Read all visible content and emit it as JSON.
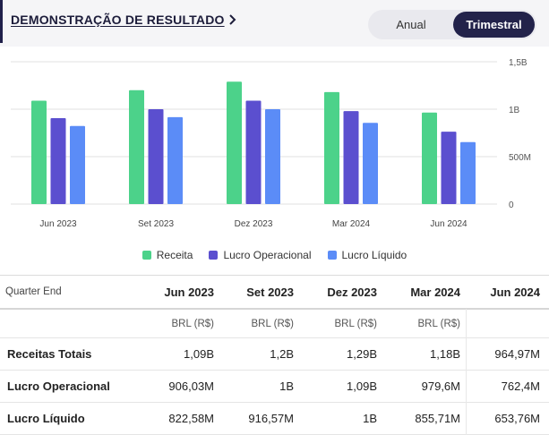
{
  "header": {
    "title": "DEMONSTRAÇÃO DE RESULTADO",
    "toggle": {
      "anual": "Anual",
      "trimestral": "Trimestral",
      "selected": "trimestral"
    }
  },
  "colors": {
    "receita": "#4cd28a",
    "lucro_operacional": "#5b4fcf",
    "lucro_liquido": "#5b8cf7",
    "accent": "#22224a"
  },
  "chart_data": {
    "type": "bar",
    "categories": [
      "Jun 2023",
      "Set 2023",
      "Dez 2023",
      "Mar 2024",
      "Jun 2024"
    ],
    "series": [
      {
        "name": "Receita",
        "values": [
          1.09,
          1.2,
          1.29,
          1.18,
          0.96497
        ]
      },
      {
        "name": "Lucro Operacional",
        "values": [
          0.90603,
          1.0,
          1.09,
          0.9796,
          0.7624
        ]
      },
      {
        "name": "Lucro Líquido",
        "values": [
          0.82258,
          0.91657,
          1.0,
          0.85571,
          0.65376
        ]
      }
    ],
    "ylim": [
      0,
      1.5
    ],
    "yticks": [
      0,
      0.5,
      1.0,
      1.5
    ],
    "ytick_labels": [
      "0",
      "500M",
      "1B",
      "1,5B"
    ],
    "grid": true,
    "legend": "bottom-center",
    "unit": "B"
  },
  "table": {
    "header_label": "Quarter End",
    "columns": [
      "Jun 2023",
      "Set 2023",
      "Dez 2023",
      "Mar 2024",
      "Jun 2024"
    ],
    "currency": [
      "BRL (R$)",
      "BRL (R$)",
      "BRL (R$)",
      "BRL (R$)",
      ""
    ],
    "rows": [
      {
        "label": "Receitas Totais",
        "values": [
          "1,09B",
          "1,2B",
          "1,29B",
          "1,18B",
          "964,97M"
        ]
      },
      {
        "label": "Lucro Operacional",
        "values": [
          "906,03M",
          "1B",
          "1,09B",
          "979,6M",
          "762,4M"
        ]
      },
      {
        "label": "Lucro Líquido",
        "values": [
          "822,58M",
          "916,57M",
          "1B",
          "855,71M",
          "653,76M"
        ]
      }
    ]
  }
}
